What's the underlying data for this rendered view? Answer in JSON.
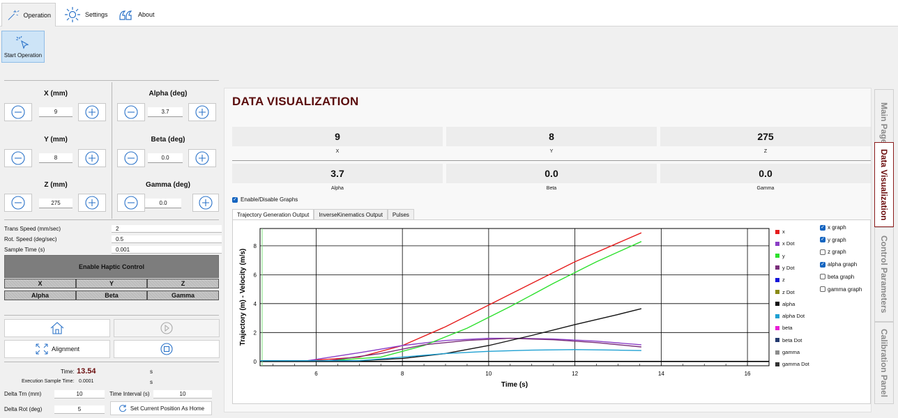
{
  "ribbon": {
    "tabs": [
      {
        "label": "Operation",
        "icon": "magic-wand-icon"
      },
      {
        "label": "Settings",
        "icon": "gear-icon"
      },
      {
        "label": "About",
        "icon": "quote-icon"
      }
    ],
    "start_operation": "Start Operation"
  },
  "axes": {
    "x": {
      "title": "X (mm)",
      "value": "9"
    },
    "y": {
      "title": "Y (mm)",
      "value": "8"
    },
    "z": {
      "title": "Z (mm)",
      "value": "275"
    },
    "alpha": {
      "title": "Alpha (deg)",
      "value": "3.7"
    },
    "beta": {
      "title": "Beta (deg)",
      "value": "0.0"
    },
    "gamma": {
      "title": "Gamma (deg)",
      "value": "0.0"
    }
  },
  "params": {
    "trans_speed": {
      "label": "Trans Speed (mm/sec)",
      "value": "2"
    },
    "rot_speed": {
      "label": "Rot. Speed (deg/sec)",
      "value": "0.5"
    },
    "sample_time": {
      "label": "Sample Time (s)",
      "value": "0.001"
    }
  },
  "haptic": {
    "button": "Enable Haptic Control",
    "row1": [
      "X",
      "Y",
      "Z"
    ],
    "row2": [
      "Alpha",
      "Beta",
      "Gamma"
    ]
  },
  "actions": {
    "alignment": "Alignment"
  },
  "status": {
    "time_label": "Time:",
    "time_value": "13.54",
    "time_unit": "s",
    "exec_label": "Execution Sample Time:",
    "exec_value": "0.0001",
    "exec_unit": "s",
    "delta_trn_label": "Delta Trn (mm)",
    "delta_trn_value": "10",
    "time_interval_label": "Time Interval (s)",
    "time_interval_value": "10",
    "delta_rot_label": "Delta Rot (deg)",
    "delta_rot_value": "5",
    "set_home": "Set Current Position As Home"
  },
  "vis": {
    "title": "DATA VISUALIZATION",
    "cards": [
      {
        "value": "9",
        "label": "X"
      },
      {
        "value": "8",
        "label": "Y"
      },
      {
        "value": "275",
        "label": "Z"
      },
      {
        "value": "3.7",
        "label": "Alpha"
      },
      {
        "value": "0.0",
        "label": "Beta"
      },
      {
        "value": "0.0",
        "label": "Gamma"
      }
    ],
    "enable_graphs": "Enable/Disable Graphs",
    "tabs": [
      "Trajectory Generation Output",
      "InverseKinematics Output",
      "Pulses"
    ],
    "graph_toggles": [
      {
        "label": "x graph",
        "checked": true
      },
      {
        "label": "y graph",
        "checked": true
      },
      {
        "label": "z graph",
        "checked": false
      },
      {
        "label": "alpha graph",
        "checked": true
      },
      {
        "label": "beta graph",
        "checked": false
      },
      {
        "label": "gamma graph",
        "checked": false
      }
    ]
  },
  "side_tabs": [
    "Main Page",
    "Data Visualization",
    "Control Parameters",
    "Calibration Panel"
  ],
  "chart_data": {
    "type": "line",
    "xlabel": "Time (s)",
    "ylabel": "Trajectory (m) - Velocity (m/s)",
    "xlim": [
      4.7,
      16.5
    ],
    "ylim": [
      -0.3,
      9.2
    ],
    "xticks": [
      6,
      8,
      10,
      12,
      14,
      16
    ],
    "yticks": [
      0,
      2,
      4,
      6,
      8
    ],
    "grid": true,
    "legend_position": "right",
    "series": [
      {
        "name": "x",
        "color": "#e51c1c",
        "points": [
          [
            4.7,
            0.05
          ],
          [
            5.8,
            0.05
          ],
          [
            7,
            0.3
          ],
          [
            8,
            1.1
          ],
          [
            9,
            2.4
          ],
          [
            10,
            3.9
          ],
          [
            11,
            5.4
          ],
          [
            12,
            6.9
          ],
          [
            13,
            8.2
          ],
          [
            13.54,
            8.9
          ]
        ]
      },
      {
        "name": "x Dot",
        "color": "#8b3fc6",
        "points": [
          [
            4.7,
            0.05
          ],
          [
            5.8,
            0.05
          ],
          [
            7,
            0.6
          ],
          [
            8,
            1.1
          ],
          [
            9,
            1.45
          ],
          [
            10,
            1.6
          ],
          [
            10.7,
            1.6
          ],
          [
            11.5,
            1.55
          ],
          [
            12.5,
            1.4
          ],
          [
            13.54,
            1.15
          ]
        ]
      },
      {
        "name": "y",
        "color": "#2de02d",
        "points": [
          [
            4.7,
            0.05
          ],
          [
            6.3,
            0.05
          ],
          [
            7.5,
            0.3
          ],
          [
            8.5,
            1.1
          ],
          [
            9.5,
            2.3
          ],
          [
            10.5,
            3.8
          ],
          [
            11.5,
            5.4
          ],
          [
            12.5,
            6.9
          ],
          [
            13.54,
            8.3
          ]
        ]
      },
      {
        "name": "y Dot",
        "color": "#7a2f7a",
        "points": [
          [
            4.7,
            0.05
          ],
          [
            6.3,
            0.05
          ],
          [
            7.5,
            0.55
          ],
          [
            8.5,
            1.15
          ],
          [
            9.5,
            1.45
          ],
          [
            10.5,
            1.6
          ],
          [
            11.5,
            1.5
          ],
          [
            12.5,
            1.3
          ],
          [
            13.54,
            1.0
          ]
        ]
      },
      {
        "name": "z",
        "color": "#1414d9",
        "points": []
      },
      {
        "name": "z Dot",
        "color": "#8a8a14",
        "points": []
      },
      {
        "name": "alpha",
        "color": "#111111",
        "points": [
          [
            4.7,
            0.05
          ],
          [
            7,
            0.05
          ],
          [
            8,
            0.2
          ],
          [
            9,
            0.55
          ],
          [
            10,
            1.1
          ],
          [
            11,
            1.8
          ],
          [
            12,
            2.55
          ],
          [
            13,
            3.25
          ],
          [
            13.54,
            3.65
          ]
        ]
      },
      {
        "name": "alpha Dot",
        "color": "#1ea0d2",
        "points": [
          [
            4.7,
            0.05
          ],
          [
            7,
            0.05
          ],
          [
            8,
            0.3
          ],
          [
            9,
            0.55
          ],
          [
            10,
            0.7
          ],
          [
            11,
            0.78
          ],
          [
            12,
            0.82
          ],
          [
            13,
            0.78
          ],
          [
            13.54,
            0.75
          ]
        ]
      },
      {
        "name": "beta",
        "color": "#e81ed6",
        "points": []
      },
      {
        "name": "beta Dot",
        "color": "#243a6e",
        "points": []
      },
      {
        "name": "gamma",
        "color": "#8c8c8c",
        "points": []
      },
      {
        "name": "gamma Dot",
        "color": "#333333",
        "points": []
      }
    ]
  }
}
